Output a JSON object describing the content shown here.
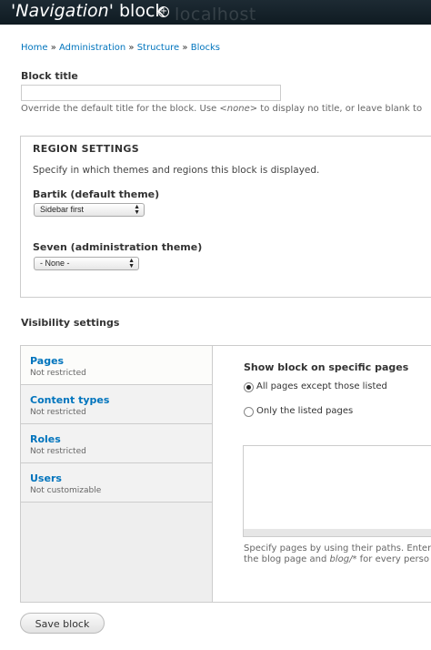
{
  "header": {
    "title_quote_open": "'",
    "title_block_name": "Navigation",
    "title_quote_close": "'",
    "title_suffix": " block",
    "shortcut_icon": "add-shortcut-icon",
    "watermark": "localhost"
  },
  "breadcrumb": {
    "items": [
      "Home",
      "Administration",
      "Structure",
      "Blocks"
    ],
    "separator": " » "
  },
  "block_title": {
    "label": "Block title",
    "value": "",
    "description_before": "Override the default title for the block. Use ",
    "description_em": "<none>",
    "description_after": " to display no title, or leave blank to"
  },
  "region_settings": {
    "legend": "REGION SETTINGS",
    "description": "Specify in which themes and regions this block is displayed.",
    "themes": [
      {
        "label": "Bartik (default theme)",
        "selected": "Sidebar first"
      },
      {
        "label": "Seven (administration theme)",
        "selected": "- None -"
      }
    ]
  },
  "visibility": {
    "heading": "Visibility settings",
    "tabs": [
      {
        "title": "Pages",
        "summary": "Not restricted"
      },
      {
        "title": "Content types",
        "summary": "Not restricted"
      },
      {
        "title": "Roles",
        "summary": "Not restricted"
      },
      {
        "title": "Users",
        "summary": "Not customizable"
      }
    ],
    "pages_pane": {
      "heading": "Show block on specific pages",
      "options": [
        {
          "label": "All pages except those listed",
          "checked": true
        },
        {
          "label": "Only the listed pages",
          "checked": false
        }
      ],
      "textarea_value": "",
      "desc_line1": "Specify pages by using their paths. Enter",
      "desc_line2_before": "the blog page and ",
      "desc_line2_em": "blog/*",
      "desc_line2_after": " for every perso"
    }
  },
  "actions": {
    "save_label": "Save block"
  }
}
